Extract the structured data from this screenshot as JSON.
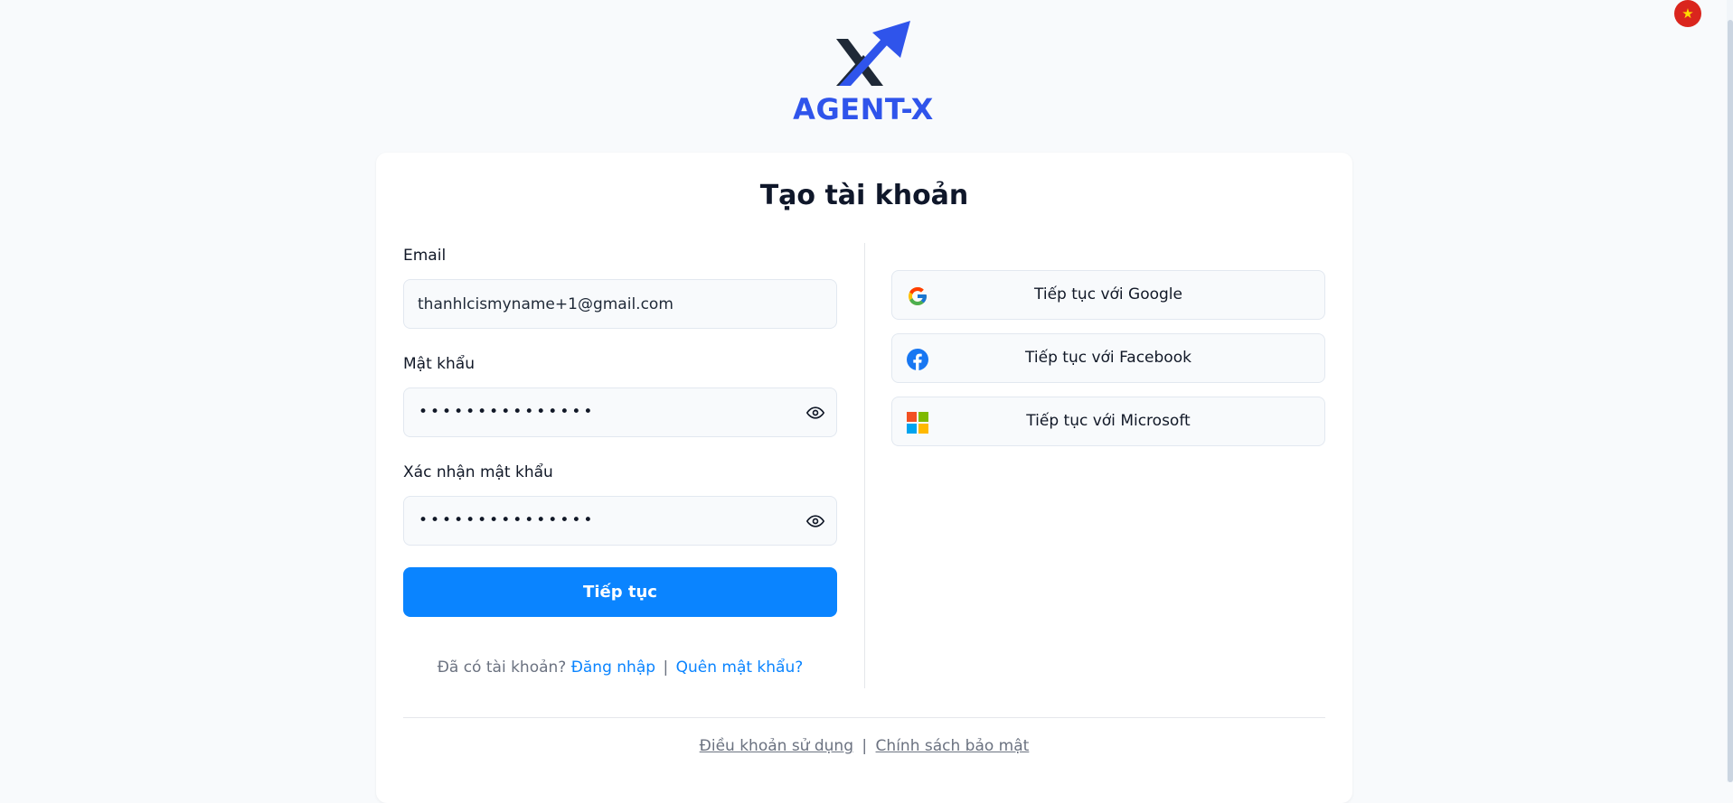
{
  "brand": {
    "name": "AGENT-X",
    "color": "#2f54eb"
  },
  "language": {
    "flag_icon": "vietnam-flag-icon",
    "flag_color": "#da251d"
  },
  "form": {
    "title": "Tạo tài khoản",
    "email_label": "Email",
    "email_value": "thanhlcismyname+1@gmail.com",
    "password_label": "Mật khẩu",
    "password_mask": "•••••••••••••••",
    "confirm_label": "Xác nhận mật khẩu",
    "confirm_mask": "•••••••••••••••",
    "submit_label": "Tiếp tục",
    "submit_color": "#0a84ff",
    "have_account_text": "Đã có tài khoản?",
    "login_link": "Đăng nhập",
    "separator": "|",
    "forgot_link": "Quên mật khẩu?"
  },
  "social": {
    "google_label": "Tiếp tục với Google",
    "facebook_label": "Tiếp tục với Facebook",
    "microsoft_label": "Tiếp tục với Microsoft"
  },
  "footer": {
    "terms_link": "Điều khoản sử dụng",
    "separator": "|",
    "privacy_link": "Chính sách bảo mật"
  }
}
